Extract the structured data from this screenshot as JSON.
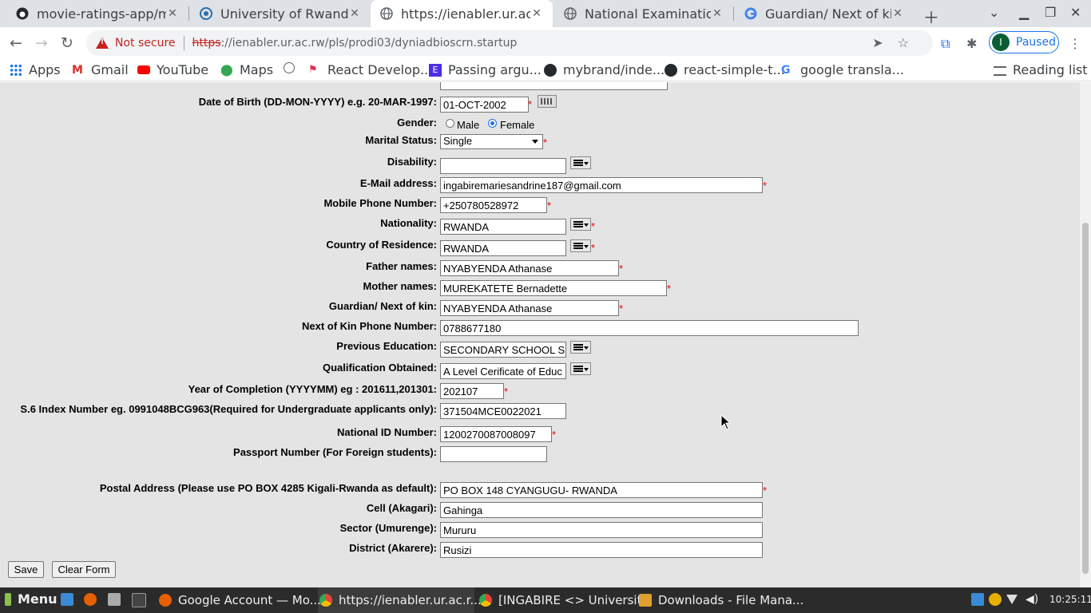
{
  "browser": {
    "tabs": [
      {
        "title": "movie-ratings-app/mai",
        "icon": "github-icon"
      },
      {
        "title": "University of Rwanda",
        "icon": "ur-logo-icon"
      },
      {
        "title": "https://ienabler.ur.ac.rw",
        "icon": "globe-icon",
        "active": true
      },
      {
        "title": "National Examination a",
        "icon": "globe-icon"
      },
      {
        "title": "Guardian/ Next of kin: s",
        "icon": "google-icon"
      }
    ],
    "not_secure": "Not secure",
    "url_scheme": "https",
    "url_rest": "://ienabler.ur.ac.rw/pls/prodi03/dyniadbioscrn.startup",
    "profile_initial": "I",
    "profile_status": "Paused"
  },
  "bookmarks": [
    "Apps",
    "Gmail",
    "YouTube",
    "Maps",
    "",
    "React Develop...",
    "Passing argu...",
    "mybrand/inde...",
    "react-simple-t...",
    "google transla..."
  ],
  "reading_list": "Reading list",
  "form": {
    "dob_label": "Date of Birth (DD-MON-YYYY) e.g. 20-MAR-1997:",
    "dob_value": "01-OCT-2002",
    "gender_label": "Gender:",
    "gender_male": "Male",
    "gender_female": "Female",
    "marital_label": "Marital Status:",
    "marital_value": "Single",
    "disability_label": "Disability:",
    "disability_value": "",
    "email_label": "E-Mail address:",
    "email_value": "ingabiremariesandrine187@gmail.com",
    "mobile_label": "Mobile Phone Number:",
    "mobile_value": "+250780528972",
    "nationality_label": "Nationality:",
    "nationality_value": "RWANDA",
    "residence_label": "Country of Residence:",
    "residence_value": "RWANDA",
    "father_label": "Father names:",
    "father_value": "NYABYENDA  Athanase",
    "mother_label": "Mother names:",
    "mother_value": "MUREKATETE Bernadette",
    "guardian_label": "Guardian/ Next of kin:",
    "guardian_value": "NYABYENDA  Athanase",
    "kinphone_label": "Next of Kin Phone Number:",
    "kinphone_value": "0788677180",
    "preved_label": "Previous Education:",
    "preved_value": "SECONDARY SCHOOL S",
    "qual_label": "Qualification Obtained:",
    "qual_value": "A Level Cerificate of Educ",
    "year_label": "Year of Completion (YYYYMM) eg : 201611,201301:",
    "year_value": "202107",
    "index_label": "S.6 Index Number eg. 0991048BCG963(Required for Undergraduate applicants only):",
    "index_value": "371504MCE0022021",
    "natid_label": "National ID Number:",
    "natid_value": "1200270087008097",
    "passport_label": "Passport Number (For Foreign students):",
    "passport_value": "",
    "postal_label": "Postal Address (Please use PO BOX 4285 Kigali-Rwanda as default):",
    "postal_value": "PO BOX 148 CYANGUGU- RWANDA",
    "cell_label": "Cell (Akagari):",
    "cell_value": "Gahinga",
    "sector_label": "Sector (Umurenge):",
    "sector_value": "Mururu",
    "district_label": "District (Akarere):",
    "district_value": "Rusizi",
    "save_label": "Save",
    "clear_label": "Clear Form",
    "required_mark": "*"
  },
  "taskbar": {
    "menu": "Menu",
    "items": [
      "Google Account — Mo...",
      "https://ienabler.ur.ac.r...",
      "[INGABIRE <> Universit...",
      "Downloads - File Mana..."
    ],
    "clock": "10:25:11"
  }
}
